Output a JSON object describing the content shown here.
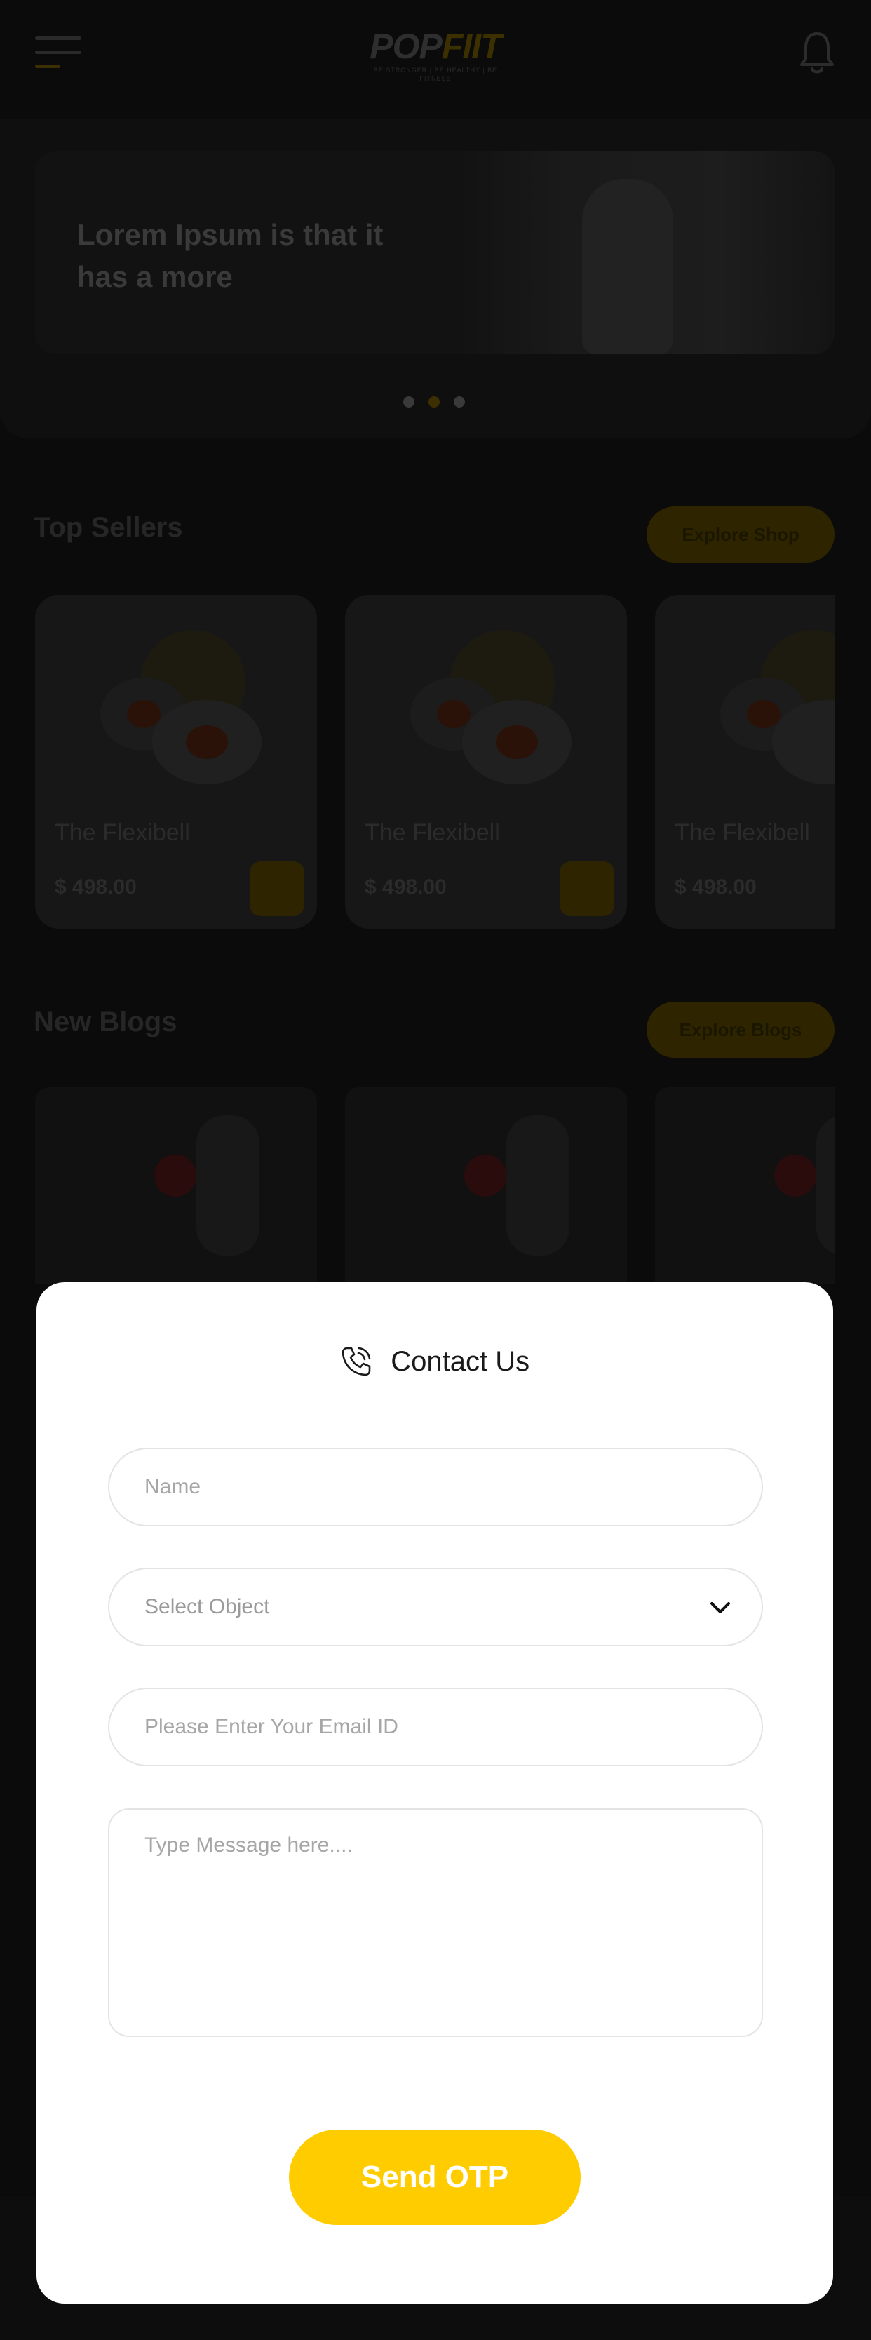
{
  "header": {
    "logo_main": "POP",
    "logo_accent": "FIIT",
    "logo_tagline": "BE STRONGER | BE HEALTHY | BE FITNESS"
  },
  "hero": {
    "text": "Lorem Ipsum is that it has a more"
  },
  "top_sellers": {
    "title": "Top Sellers",
    "button_label": "Explore Shop",
    "products": [
      {
        "name": "The Flexibell",
        "price": "$ 498.00"
      },
      {
        "name": "The Flexibell",
        "price": "$ 498.00"
      },
      {
        "name": "The Flexibell",
        "price": "$ 498.00"
      }
    ]
  },
  "new_blogs": {
    "title": "New Blogs",
    "button_label": "Explore Blogs"
  },
  "contact_modal": {
    "title": "Contact Us",
    "name_placeholder": "Name",
    "select_placeholder": "Select Object",
    "email_placeholder": "Please Enter Your Email ID",
    "message_placeholder": "Type Message here....",
    "submit_label": "Send OTP"
  },
  "colors": {
    "accent": "#FFCC00",
    "modal_bg": "#FFFFFF",
    "overlay": "#000000"
  }
}
